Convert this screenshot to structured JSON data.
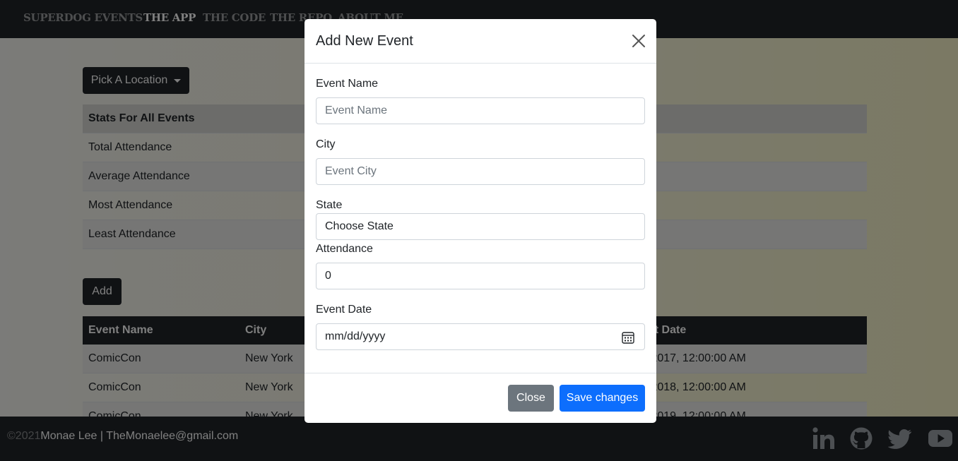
{
  "navbar": {
    "links": [
      "SUPERDOG EVENTS",
      "THE APP",
      "THE CODE",
      "THE REPO",
      "ABOUT ME"
    ]
  },
  "controls": {
    "location_button": "Pick A Location",
    "add_button": "Add"
  },
  "stats_table": {
    "header": "Stats For All Events",
    "rows": [
      "Total Attendance",
      "Average Attendance",
      "Most Attendance",
      "Least Attendance"
    ]
  },
  "events_table": {
    "columns": [
      "Event Name",
      "City",
      "",
      "",
      "Event Date"
    ],
    "visible_column_fragments": {
      "event_date": "nt Date"
    },
    "rows": [
      {
        "name": "ComicCon",
        "city": "New York",
        "date": "/2017, 12:00:00 AM"
      },
      {
        "name": "ComicCon",
        "city": "New York",
        "date": "/2018, 12:00:00 AM"
      },
      {
        "name": "ComicCon",
        "city": "New York",
        "date": "/2019, 12:00:00 AM"
      }
    ]
  },
  "modal": {
    "title": "Add New Event",
    "fields": {
      "event_name": {
        "label": "Event Name",
        "placeholder": "Event Name",
        "value": ""
      },
      "city": {
        "label": "City",
        "placeholder": "Event City",
        "value": ""
      },
      "state": {
        "label": "State",
        "selected": "Choose State"
      },
      "attendance": {
        "label": "Attendance",
        "value": "0"
      },
      "event_date": {
        "label": "Event Date",
        "placeholder": "mm/dd/yyyy"
      }
    },
    "close_button": "Close",
    "save_button": "Save changes"
  },
  "footer": {
    "copyright": "©2021",
    "contact": "Monae Lee | TheMonaelee@gmail.com",
    "social_icons": [
      "linkedin-icon",
      "github-icon",
      "twitter-icon",
      "youtube-icon"
    ]
  },
  "colors": {
    "dark": "#212529",
    "primary": "#0d6efd",
    "secondary": "#6c757d",
    "page_tint": "#f6f3c8"
  }
}
